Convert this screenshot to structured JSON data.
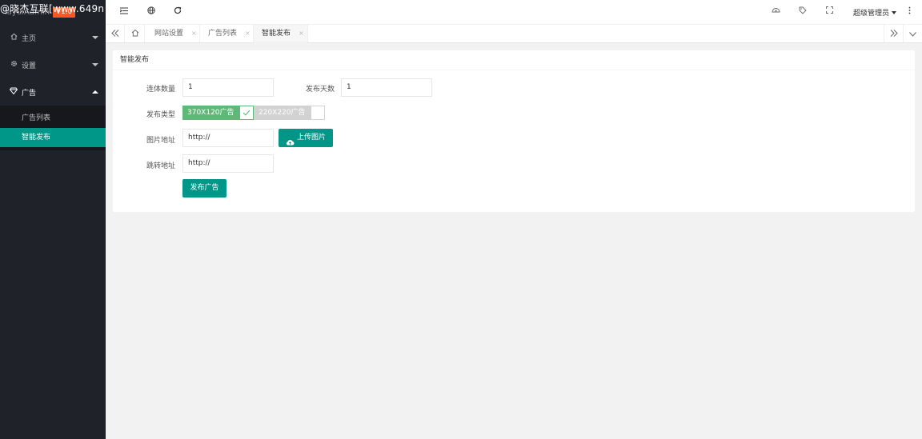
{
  "app": {
    "logo_text": "layuiAdmin",
    "logo_badge": "V1.0",
    "watermark": "@晓杰互联[www.649n"
  },
  "sidebar": {
    "items": [
      {
        "label": "主页",
        "icon": "home-icon",
        "expanded": false
      },
      {
        "label": "设置",
        "icon": "gear-icon",
        "expanded": false
      },
      {
        "label": "广告",
        "icon": "diamond-icon",
        "expanded": true,
        "children": [
          {
            "label": "广告列表",
            "active": false
          },
          {
            "label": "智能发布",
            "active": true
          }
        ]
      }
    ]
  },
  "header": {
    "left_icons": [
      "menu-shrink-icon",
      "globe-icon",
      "refresh-icon"
    ],
    "right_icons": [
      "theme-icon",
      "tag-icon",
      "fullscreen-icon"
    ],
    "user_name": "超级管理员",
    "more_icon": "more-vertical-icon"
  },
  "tabs": {
    "items": [
      {
        "label": "网站设置",
        "active": false
      },
      {
        "label": "广告列表",
        "active": false
      },
      {
        "label": "智能发布",
        "active": true
      }
    ],
    "close_symbol": "×"
  },
  "form": {
    "card_title": "智能发布",
    "count_label": "连体数量",
    "count_value": "1",
    "days_label": "发布天数",
    "days_value": "1",
    "type_label": "发布类型",
    "type_options": [
      {
        "label": "370X120广告",
        "checked": true
      },
      {
        "label": "220X220广告",
        "checked": false
      }
    ],
    "image_label": "图片地址",
    "image_value": "http://",
    "upload_button": "上传图片",
    "link_label": "跳转地址",
    "link_value": "http://",
    "submit_button": "发布广告"
  },
  "colors": {
    "sidebar_bg": "#20222a",
    "accent": "#009688",
    "checked": "#5fb878",
    "unchecked": "#d2d2d2",
    "page_bg": "#f2f2f2"
  }
}
